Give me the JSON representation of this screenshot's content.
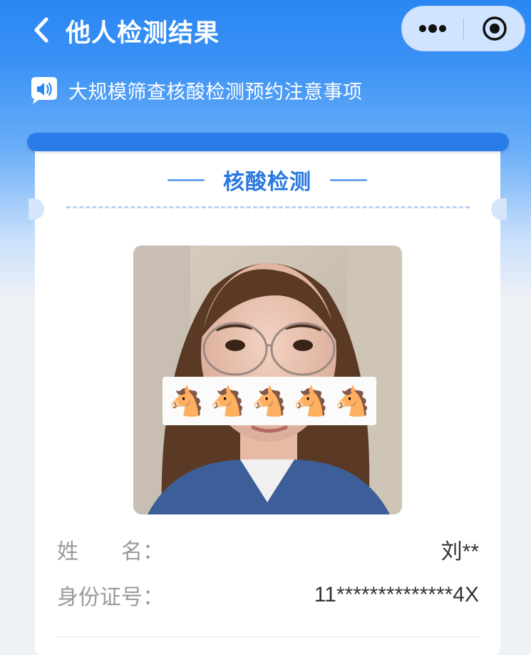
{
  "nav": {
    "title": "他人检测结果",
    "back_icon": "chevron-left-icon",
    "more_icon": "more-dots-icon",
    "close_icon": "target-close-icon"
  },
  "notice": {
    "icon": "speaker-icon",
    "text": "大规模筛查核酸检测预约注意事项"
  },
  "card": {
    "section_title": "核酸检测",
    "photo": {
      "description_icon": "portrait-photo",
      "overlay_emojis": [
        "🐴",
        "🐴",
        "🐴",
        "🐴",
        "🐴"
      ]
    },
    "fields": [
      {
        "label": "姓　　名：",
        "value": "刘**"
      },
      {
        "label": "身份证号：",
        "value": "11**************4X"
      }
    ]
  },
  "colors": {
    "brand_blue": "#2a86f3",
    "card_bar": "#2a7ce8",
    "section_title": "#2878e0",
    "label_gray": "#9a9a9a",
    "value_dark": "#333333"
  }
}
